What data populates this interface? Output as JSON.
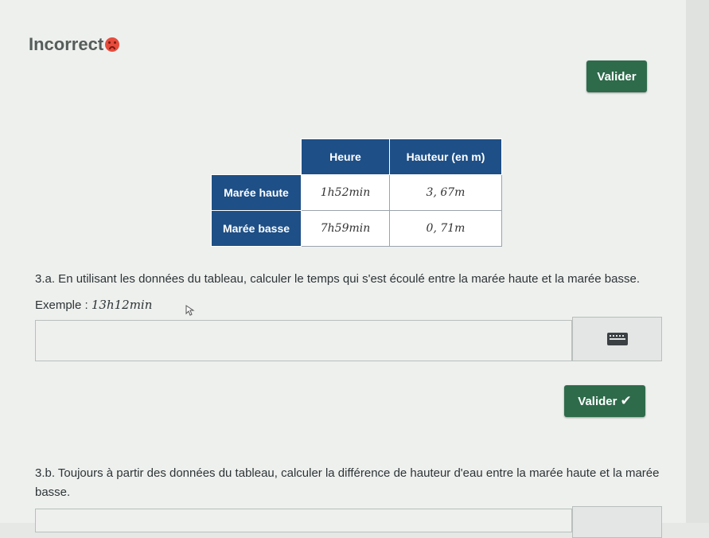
{
  "status": {
    "text": "Incorrect",
    "icon": "sad-face-icon"
  },
  "buttons": {
    "validate_top": "Valider",
    "validate_mid": "Valider"
  },
  "table": {
    "headers": [
      "",
      "Heure",
      "Hauteur (en m)"
    ],
    "rows": [
      {
        "label": "Marée haute",
        "heure": "1h52min",
        "hauteur": "3, 67m"
      },
      {
        "label": "Marée basse",
        "heure": "7h59min",
        "hauteur": "0, 71m"
      }
    ]
  },
  "question_a": {
    "text": "3.a. En utilisant les données du tableau, calculer le temps qui s'est écoulé entre la marée haute et la marée basse.",
    "example_label": "Exemple :",
    "example_value": "13h12min",
    "answer_value": ""
  },
  "question_b": {
    "text": "3.b. Toujours à partir des données du tableau, calculer la différence de hauteur d'eau entre la marée haute et la marée basse.",
    "answer_value": ""
  },
  "colors": {
    "accent_button": "#2e6b4b",
    "table_header": "#1e4f86",
    "error": "#e74c3c"
  }
}
